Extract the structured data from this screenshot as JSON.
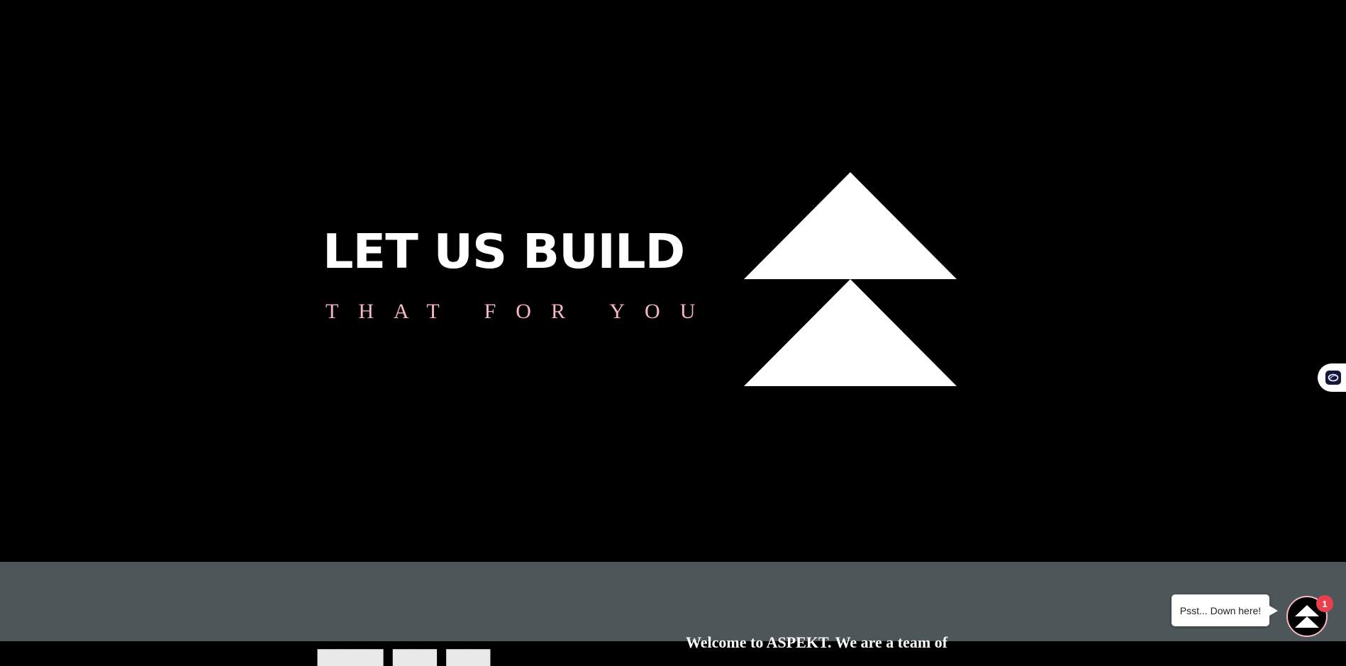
{
  "hero": {
    "headline": "LET US BUILD",
    "subline": "THAT FOR YOU",
    "logo_icon": "double-triangle-logo-icon"
  },
  "side_widget": {
    "icon": "accessibility-toggle-icon"
  },
  "next_section": {
    "left_heading_partial": "▄▄▄  ▄▄ ▄▄",
    "right_text_partial": "Welcome to ASPEKT. We are a team of"
  },
  "chat": {
    "tooltip": "Psst... Down here!",
    "badge_count": "1",
    "launcher_icon": "double-triangle-logo-icon"
  },
  "colors": {
    "background": "#000000",
    "accent_pink": "#f6b8c4",
    "band_gray": "#4d5759",
    "badge_red": "#e8404f"
  }
}
